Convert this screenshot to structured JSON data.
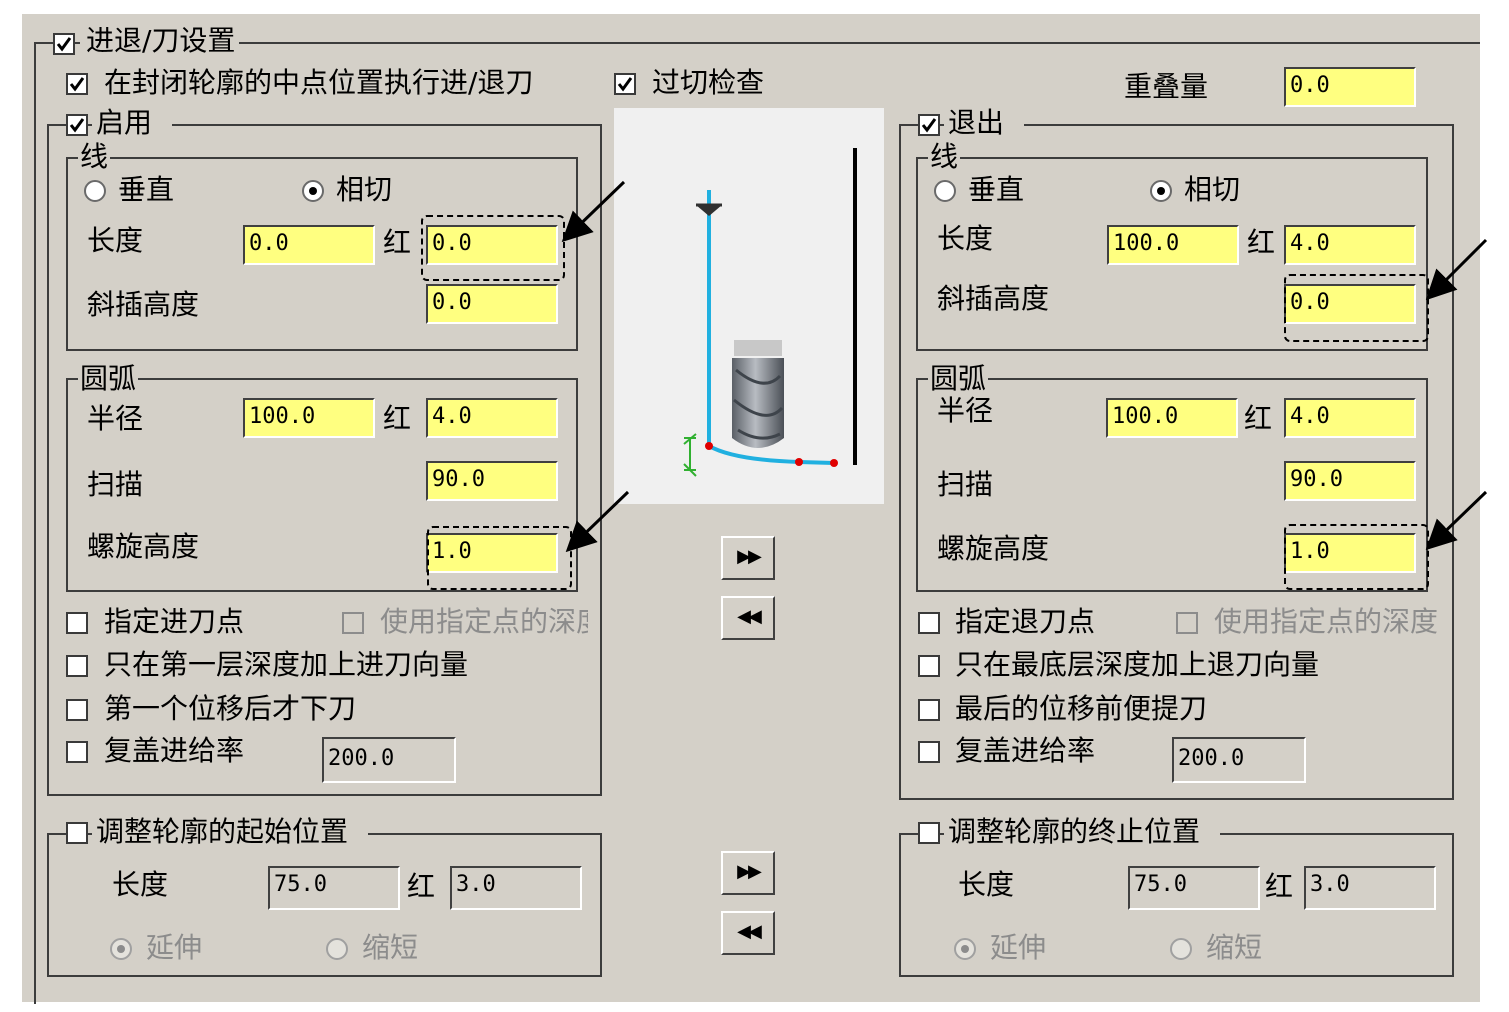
{
  "section_title": "进退/刀设置",
  "midpoint_option": "在封闭轮廓的中点位置执行进/退刀",
  "gouge_check": "过切检查",
  "overlap": {
    "label": "重叠量",
    "value": "0.0"
  },
  "entry": {
    "title": "启用",
    "line": {
      "title": "线",
      "vertical": "垂直",
      "tangent": "相切",
      "length_label": "长度",
      "length": "0.0",
      "ratio_icon": "红",
      "length_ratio": "0.0",
      "ramp_label": "斜插高度",
      "ramp": "0.0"
    },
    "arc": {
      "title": "圆弧",
      "radius_label": "半径",
      "radius": "100.0",
      "ratio_icon": "红",
      "radius_ratio": "4.0",
      "sweep_label": "扫描",
      "sweep": "90.0",
      "helix_label": "螺旋高度",
      "helix": "1.0"
    },
    "specify_point": "指定进刀点",
    "use_point_depth": "使用指定点的深度",
    "first_depth_only": "只在第一层深度加上进刀向量",
    "after_first_move": "第一个位移后才下刀",
    "override_feed": "复盖进给率",
    "feed": "200.0"
  },
  "exit": {
    "title": "退出",
    "line": {
      "title": "线",
      "vertical": "垂直",
      "tangent": "相切",
      "length_label": "长度",
      "length": "100.0",
      "ratio_icon": "红",
      "length_ratio": "4.0",
      "ramp_label": "斜插高度",
      "ramp": "0.0"
    },
    "arc": {
      "title": "圆弧",
      "radius_label": "半径",
      "radius": "100.0",
      "ratio_icon": "红",
      "radius_ratio": "4.0",
      "sweep_label": "扫描",
      "sweep": "90.0",
      "helix_label": "螺旋高度",
      "helix": "1.0"
    },
    "specify_point": "指定退刀点",
    "use_point_depth": "使用指定点的深度",
    "bottom_depth_only": "只在最底层深度加上退刀向量",
    "before_last_move": "最后的位移前便提刀",
    "override_feed": "复盖进给率",
    "feed": "200.0"
  },
  "adjust_start": {
    "title": "调整轮廓的起始位置",
    "length_label": "长度",
    "length": "75.0",
    "ratio_icon": "红",
    "ratio": "3.0",
    "extend": "延伸",
    "shorten": "缩短"
  },
  "adjust_end": {
    "title": "调整轮廓的终止位置",
    "length_label": "长度",
    "length": "75.0",
    "ratio_icon": "红",
    "ratio": "3.0",
    "extend": "延伸",
    "shorten": "缩短"
  },
  "copy_buttons": {
    "forward": "▶▶",
    "back": "◀◀"
  }
}
